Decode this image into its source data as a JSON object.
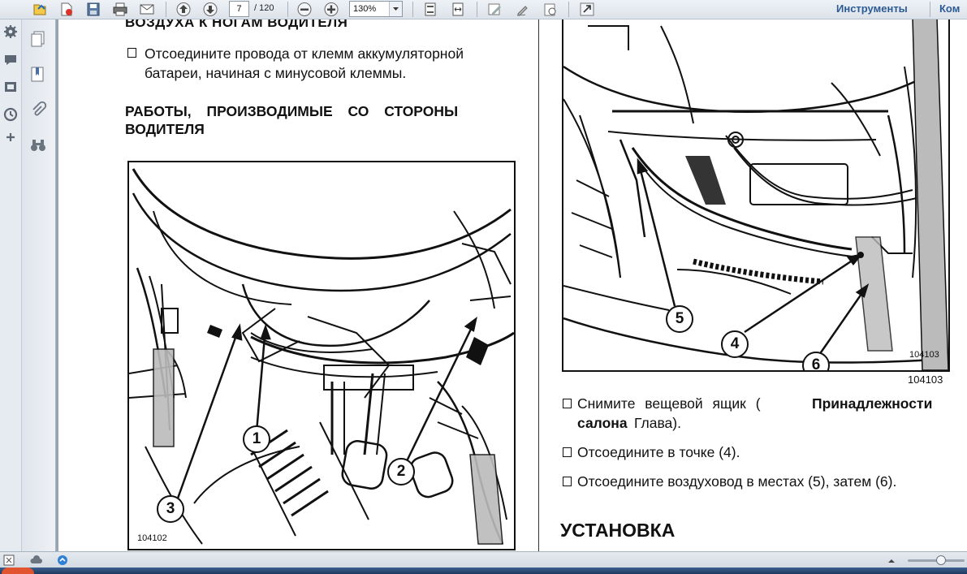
{
  "toolbar": {
    "page_current": "7",
    "page_total": "/ 120",
    "zoom": "130%",
    "tools_label": "Инструменты",
    "comment_label": "Ком"
  },
  "left_page": {
    "heading_top": "ВОЗДУХА К НОГАМ ВОДИТЕЛЯ",
    "step1_line1": "Отсоедините провода от клемм аккумуляторной",
    "step1_line2": "батареи, начиная с минусовой клеммы.",
    "heading_line1": "РАБОТЫ, ПРОИЗВОДИМЫЕ СО СТОРОНЫ",
    "heading_line2": "ВОДИТЕЛЯ",
    "figure_code": "104102",
    "callouts": [
      "1",
      "2",
      "3"
    ]
  },
  "right_page": {
    "figure_code_inner": "104103",
    "figure_code_outer": "104103",
    "callouts": [
      "5",
      "4",
      "6"
    ],
    "step1_a": "Снимите вещевой ящик (",
    "step1_b": "Принадлежности",
    "step1_c": "салона",
    "step1_d": "Глава).",
    "step2": "Отсоедините в точке (4).",
    "step3": "Отсоедините воздуховод в местах (5), затем (6).",
    "heading": "УСТАНОВКА"
  },
  "colors": {
    "toolbar_bg": "#e6ebf1",
    "link": "#2c5b94",
    "page_bg": "#ffffff"
  }
}
